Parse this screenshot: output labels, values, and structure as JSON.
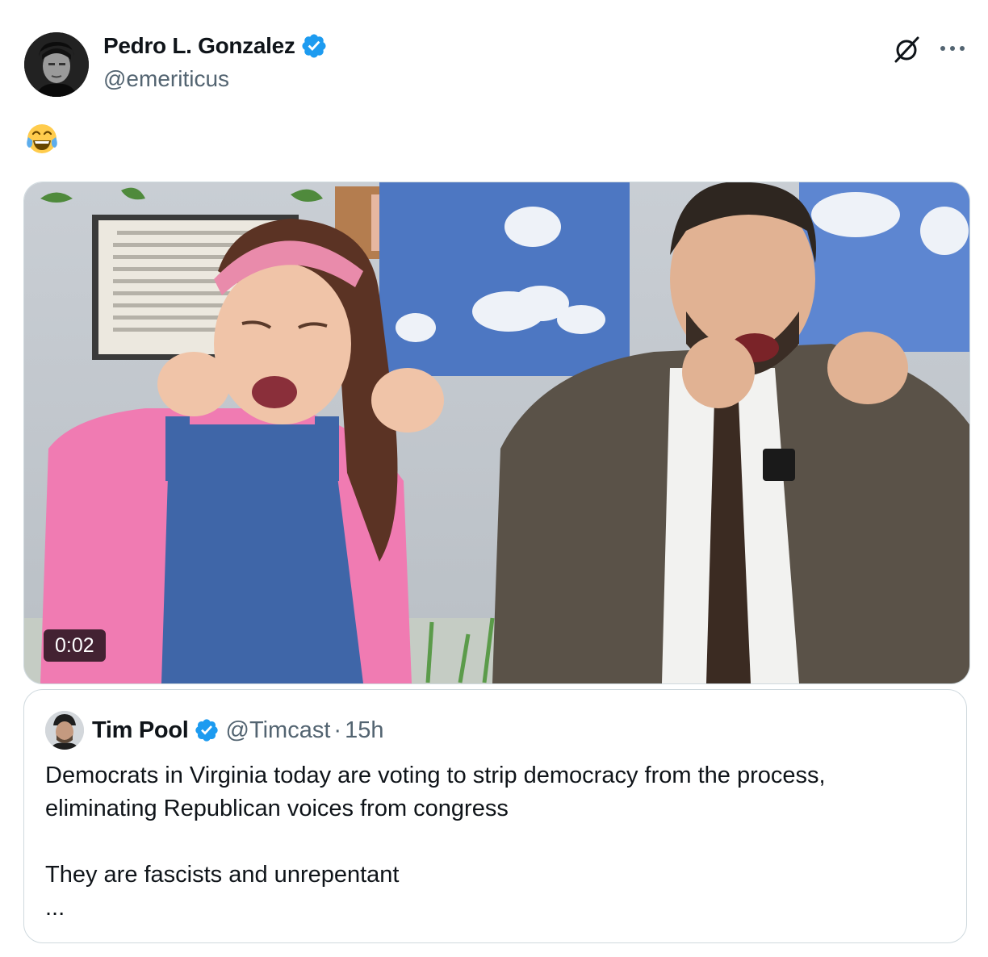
{
  "author": {
    "display_name": "Pedro L. Gonzalez",
    "handle": "@emeriticus",
    "verified": true
  },
  "post": {
    "emoji": "😂",
    "video": {
      "duration": "0:02"
    }
  },
  "quoted_post": {
    "display_name": "Tim Pool",
    "handle": "@Timcast",
    "separator": "·",
    "time": "15h",
    "verified": true,
    "lines": [
      "Democrats in Virginia today are voting to strip democracy from the process,",
      "eliminating Republican voices from congress",
      "They are fascists and unrepentant",
      "..."
    ]
  },
  "colors": {
    "verified_blue": "#1d9bf0",
    "secondary_text": "#536471",
    "border": "#cfd9de"
  },
  "icons": {
    "grok": "grok-icon",
    "more": "more-icon",
    "verified": "verified-badge-icon"
  }
}
